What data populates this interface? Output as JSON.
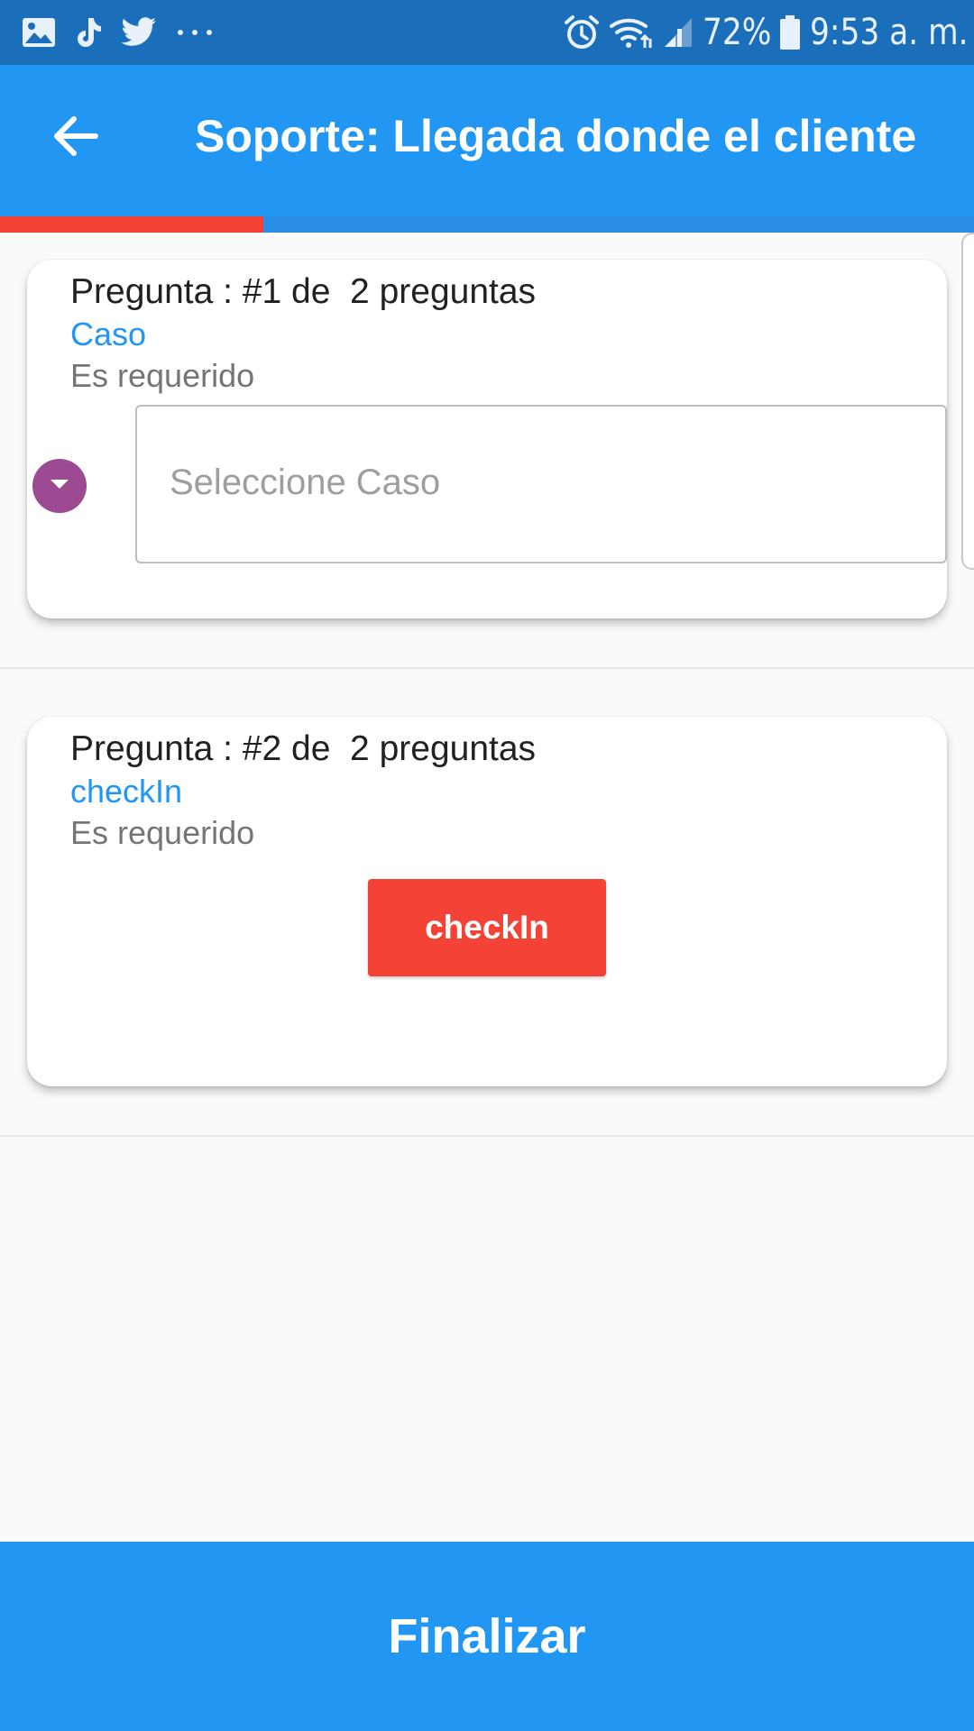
{
  "status_bar": {
    "icons_left": [
      "gallery-icon",
      "tiktok-icon",
      "twitter-icon",
      "more-dots-icon"
    ],
    "icons_right": [
      "alarm-icon",
      "wifi-icon",
      "signal-icon",
      "battery-icon"
    ],
    "battery": "72%",
    "time": "9:53 a. m."
  },
  "app_bar": {
    "back_icon": "arrow-left-icon",
    "title": "Soporte: Llegada donde el cliente"
  },
  "progress": {
    "value": 0.27,
    "fill_color": "#f44336"
  },
  "questions": [
    {
      "header": "Pregunta : #1 de  2 preguntas",
      "label": "Caso",
      "required": "Es requerido",
      "dropdown_icon": "caret-down-icon",
      "select_placeholder": "Seleccione Caso"
    },
    {
      "header": "Pregunta : #2 de  2 preguntas",
      "label": "checkIn",
      "required": "Es requerido",
      "button_label": "checkIn"
    }
  ],
  "footer": {
    "finalize_label": "Finalizar"
  },
  "colors": {
    "primary": "#2196f3",
    "status_bar": "#1b6fba",
    "accent_red": "#f44336",
    "dropdown_purple": "#9c4a91"
  }
}
